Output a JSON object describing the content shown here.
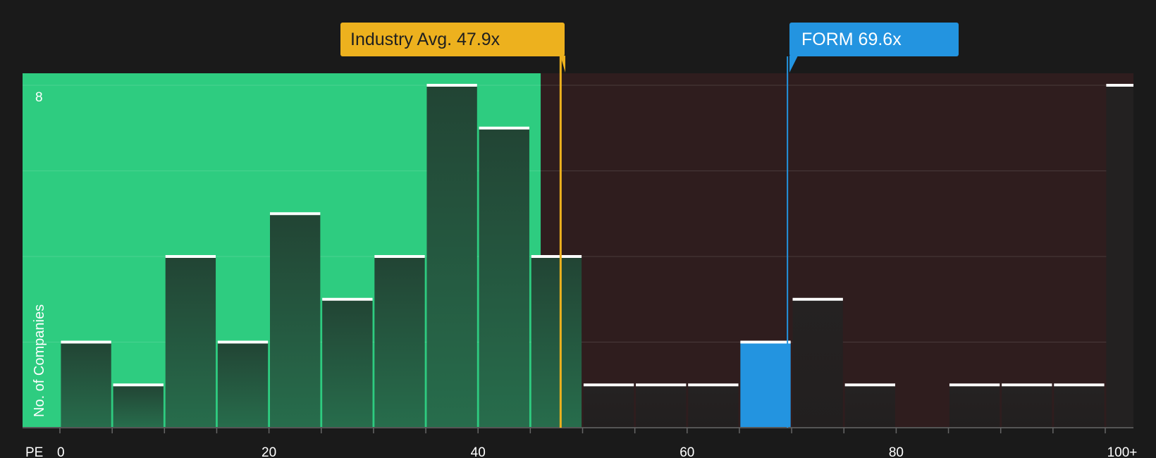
{
  "chart_data": {
    "type": "bar",
    "xlabel": "PE",
    "ylabel": "No. of Companies",
    "x_ticks": [
      "0",
      "20",
      "40",
      "60",
      "80",
      "100+"
    ],
    "y_ticks": [
      "8"
    ],
    "ylim": [
      0,
      8
    ],
    "xlim": [
      0,
      100
    ],
    "bin_width": 5,
    "bins": [
      {
        "start": 0,
        "end": 5,
        "value": 2
      },
      {
        "start": 5,
        "end": 10,
        "value": 1
      },
      {
        "start": 10,
        "end": 15,
        "value": 4
      },
      {
        "start": 15,
        "end": 20,
        "value": 2
      },
      {
        "start": 20,
        "end": 25,
        "value": 5
      },
      {
        "start": 25,
        "end": 30,
        "value": 3
      },
      {
        "start": 30,
        "end": 35,
        "value": 4
      },
      {
        "start": 35,
        "end": 40,
        "value": 8
      },
      {
        "start": 40,
        "end": 45,
        "value": 7
      },
      {
        "start": 45,
        "end": 50,
        "value": 4
      },
      {
        "start": 50,
        "end": 55,
        "value": 1
      },
      {
        "start": 55,
        "end": 60,
        "value": 1
      },
      {
        "start": 60,
        "end": 65,
        "value": 1
      },
      {
        "start": 65,
        "end": 70,
        "value": 2,
        "highlight": true
      },
      {
        "start": 70,
        "end": 75,
        "value": 3
      },
      {
        "start": 75,
        "end": 80,
        "value": 1
      },
      {
        "start": 80,
        "end": 85,
        "value": 0
      },
      {
        "start": 85,
        "end": 90,
        "value": 1
      },
      {
        "start": 90,
        "end": 95,
        "value": 1
      },
      {
        "start": 95,
        "end": 100,
        "value": 1
      },
      {
        "start": 100,
        "end": 105,
        "value": 8
      }
    ],
    "fair_region_end": 46,
    "industry_avg": {
      "label": "Industry Avg. 47.9x",
      "value": 47.9
    },
    "company": {
      "label": "FORM 69.6x",
      "value": 69.6
    },
    "grid": true,
    "colors": {
      "fair_region": "#2ecc80",
      "over_region": "#2f1d1e",
      "bar_fair": "#234d39",
      "bar_over": "#242121",
      "bar_highlight": "#2394e0",
      "industry": "#edb11e",
      "company": "#2394e0",
      "cap": "#ffffff"
    }
  }
}
